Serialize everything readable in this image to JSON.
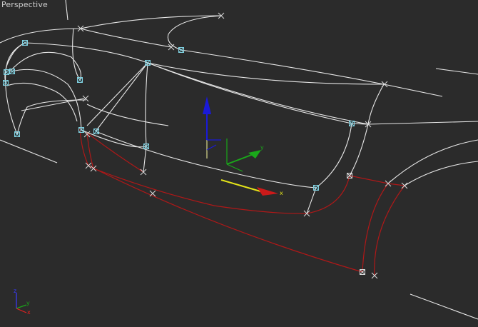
{
  "viewport": {
    "label": "Perspective",
    "background": "#2b2b2b",
    "wire_color": "#e8e8e8",
    "selected_spline_color": "#b01818"
  },
  "transform_gizmo": {
    "x_label": "x",
    "y_label": "y",
    "x_color": "#cc1a1a",
    "y_color": "#1aa81a",
    "z_color": "#1a1ad8",
    "plane_color": "#e6e619"
  },
  "view_axis_tripod": {
    "x_label": "x",
    "y_label": "y",
    "z_label": "z"
  }
}
